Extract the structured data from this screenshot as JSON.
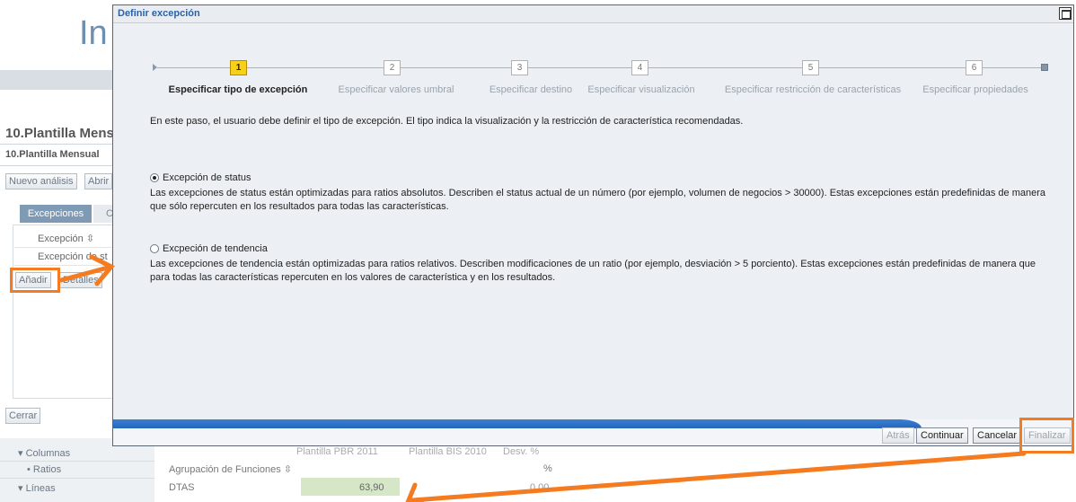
{
  "background_app": {
    "logo_text": "In",
    "report_title": "10.Plantilla Mens",
    "report_subtitle": "10.Plantilla Mensual",
    "new_analysis_button": "Nuevo análisis",
    "open_button": "Abrir",
    "tab_exceptions": "Excepciones",
    "tab_other": "C",
    "column_header": "Excepción",
    "row_item": "Excepción de st",
    "add_button": "Añadir",
    "details_button": "Detalles",
    "close_button": "Cerrar",
    "tree": {
      "columns": "Columnas",
      "ratios": "Ratios",
      "lines": "Líneas"
    },
    "grid": {
      "header_cols": [
        "Plantilla PBR 2011",
        "Plantilla BIS 2010",
        "Desv. %"
      ],
      "group_label": "Agrupación de Funciones",
      "unit": "%",
      "row_label": "DTAS",
      "row_value": "63,90",
      "row_value2": "0,00"
    }
  },
  "dialog": {
    "title": "Definir excepción",
    "intro": "En este paso, el usuario debe definir el tipo de excepción. El tipo indica la visualización y la restricción de característica recomendadas.",
    "steps": [
      {
        "number": "1",
        "label": "Especificar tipo de excepción",
        "active": true
      },
      {
        "number": "2",
        "label": "Especificar valores umbral",
        "active": false
      },
      {
        "number": "3",
        "label": "Especificar destino",
        "active": false
      },
      {
        "number": "4",
        "label": "Especificar visualización",
        "active": false
      },
      {
        "number": "5",
        "label": "Especificar restricción de características",
        "active": false
      },
      {
        "number": "6",
        "label": "Especificar propiedades",
        "active": false
      }
    ],
    "options": [
      {
        "label": "Excepción de status",
        "checked": true,
        "description": "Las excepciones de status están optimizadas para ratios absolutos. Describen el status actual de un número (por ejemplo, volumen de negocios > 30000). Estas excepciones están predefinidas de manera que sólo repercuten en los resultados para todas las características."
      },
      {
        "label": "Excpeción de tendencia",
        "checked": false,
        "description": "Las excepciones de tendencia están optimizadas para ratios relativos. Describen modificaciones de un ratio (por ejemplo, desviación > 5 porciento). Estas excepciones están predefinidas de manera que para todas las características repercuten en los valores de característica y en los resultados."
      }
    ],
    "buttons": {
      "back": "Atrás",
      "continue": "Continuar",
      "cancel": "Cancelar",
      "finish": "Finalizar"
    }
  },
  "colors": {
    "highlight": "#f47b20",
    "active_step": "#f7d117",
    "dialog_title": "#2962a8",
    "progress_bar": "#2a6ec8"
  }
}
